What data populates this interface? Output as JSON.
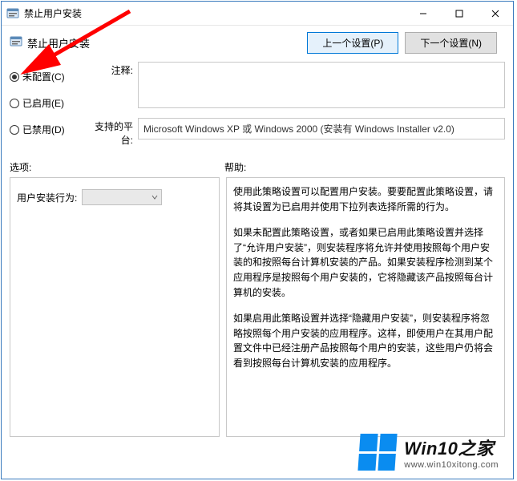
{
  "window": {
    "title": "禁止用户安装",
    "header": "禁止用户安装"
  },
  "nav": {
    "prev": "上一个设置(P)",
    "next": "下一个设置(N)"
  },
  "radios": {
    "not_configured": "未配置(C)",
    "enabled": "已启用(E)",
    "disabled": "已禁用(D)"
  },
  "fields": {
    "comment_label": "注释:",
    "platform_label": "支持的平台:",
    "platform_value": "Microsoft Windows XP 或 Windows 2000 (安装有 Windows Installer v2.0)"
  },
  "section_labels": {
    "options": "选项:",
    "help": "帮助:"
  },
  "options": {
    "behavior_label": "用户安装行为:"
  },
  "help": {
    "p1": "使用此策略设置可以配置用户安装。要要配置此策略设置，请将其设置为已启用并使用下拉列表选择所需的行为。",
    "p2": "如果未配置此策略设置，或者如果已启用此策略设置并选择了“允许用户安装”，则安装程序将允许并使用按照每个用户安装的和按照每台计算机安装的产品。如果安装程序检测到某个应用程序是按照每个用户安装的，它将隐藏该产品按照每台计算机的安装。",
    "p3": "如果启用此策略设置并选择“隐藏用户安装”，则安装程序将忽略按照每个用户安装的应用程序。这样，即使用户在其用户配置文件中已经注册产品按照每个用户的安装，这些用户仍将会看到按照每台计算机安装的应用程序。"
  },
  "watermark": {
    "name": "Win10之家",
    "url": "www.win10xitong.com"
  }
}
